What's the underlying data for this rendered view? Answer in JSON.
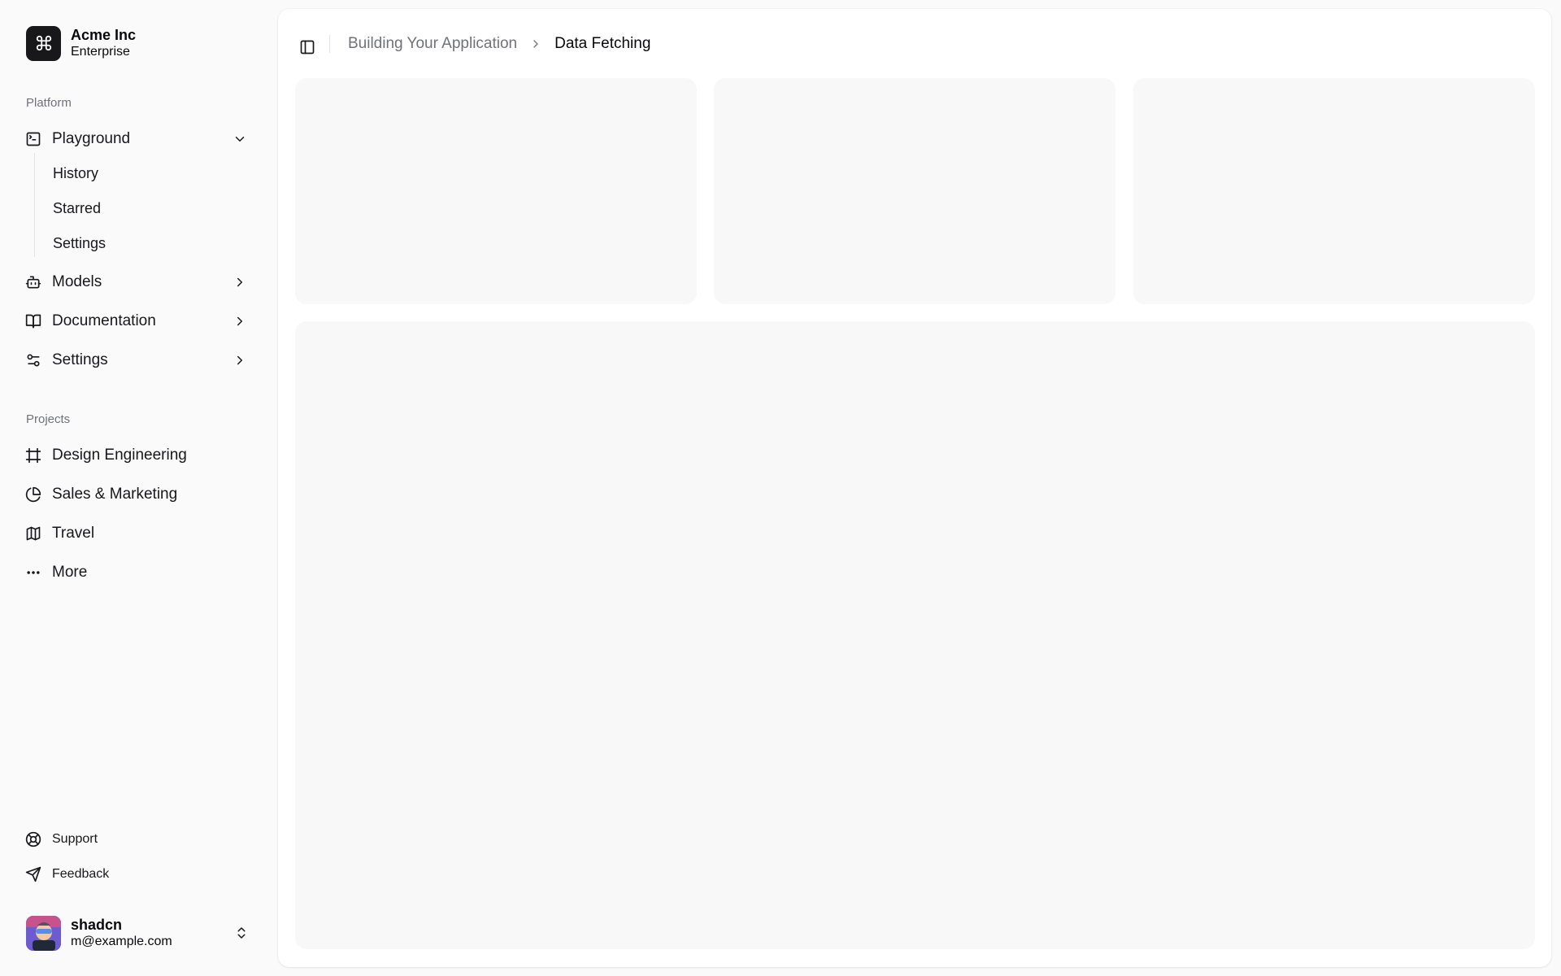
{
  "team": {
    "name": "Acme Inc",
    "plan": "Enterprise",
    "logo_icon": "command-icon"
  },
  "platform": {
    "label": "Platform",
    "items": [
      {
        "label": "Playground",
        "icon": "terminal-square-icon",
        "expanded": true,
        "subitems": [
          {
            "label": "History"
          },
          {
            "label": "Starred"
          },
          {
            "label": "Settings"
          }
        ]
      },
      {
        "label": "Models",
        "icon": "bot-icon",
        "expanded": false
      },
      {
        "label": "Documentation",
        "icon": "book-open-icon",
        "expanded": false
      },
      {
        "label": "Settings",
        "icon": "settings-2-icon",
        "expanded": false
      }
    ]
  },
  "projects": {
    "label": "Projects",
    "items": [
      {
        "label": "Design Engineering",
        "icon": "frame-icon"
      },
      {
        "label": "Sales & Marketing",
        "icon": "pie-chart-icon"
      },
      {
        "label": "Travel",
        "icon": "map-icon"
      },
      {
        "label": "More",
        "icon": "more-horizontal-icon"
      }
    ]
  },
  "secondary": {
    "items": [
      {
        "label": "Support",
        "icon": "life-buoy-icon"
      },
      {
        "label": "Feedback",
        "icon": "send-icon"
      }
    ]
  },
  "user": {
    "name": "shadcn",
    "email": "m@example.com"
  },
  "breadcrumb": {
    "parent": "Building Your Application",
    "current": "Data Fetching"
  },
  "colors": {
    "sidebar_bg": "#fafafa",
    "main_bg": "#ffffff",
    "placeholder_bg": "#f4f4f5",
    "muted_text": "#71717a",
    "logo_bg": "#18181b"
  }
}
